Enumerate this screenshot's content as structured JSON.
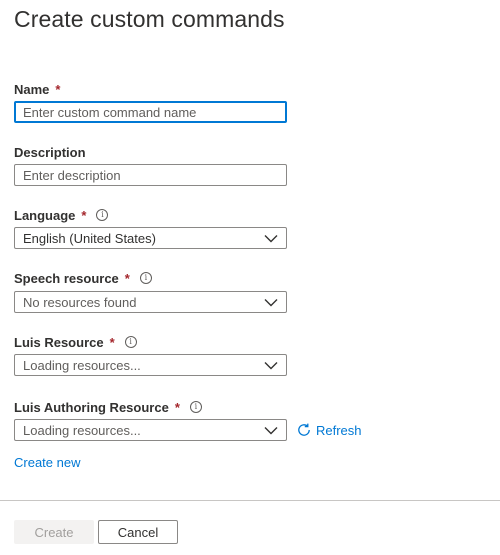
{
  "title": "Create custom commands",
  "fields": {
    "name": {
      "label": "Name",
      "required": "*",
      "placeholder": "Enter custom command name"
    },
    "description": {
      "label": "Description",
      "placeholder": "Enter description"
    },
    "language": {
      "label": "Language",
      "required": "*",
      "info": "i",
      "value": "English (United States)"
    },
    "speech": {
      "label": "Speech resource",
      "required": "*",
      "info": "i",
      "value": "No resources found"
    },
    "luis": {
      "label": "Luis Resource",
      "required": "*",
      "info": "i",
      "value": "Loading resources..."
    },
    "luis_authoring": {
      "label": "Luis Authoring Resource",
      "required": "*",
      "info": "i",
      "value": "Loading resources..."
    }
  },
  "refresh_label": "Refresh",
  "create_new_label": "Create new",
  "buttons": {
    "create": "Create",
    "cancel": "Cancel"
  },
  "colors": {
    "accent": "#0078d4",
    "required": "#a4262c",
    "disabled_bg": "#f3f2f1",
    "disabled_text": "#a19f9d"
  },
  "icons": {
    "info": "info-icon",
    "chevron": "chevron-down-icon",
    "refresh": "refresh-icon"
  }
}
